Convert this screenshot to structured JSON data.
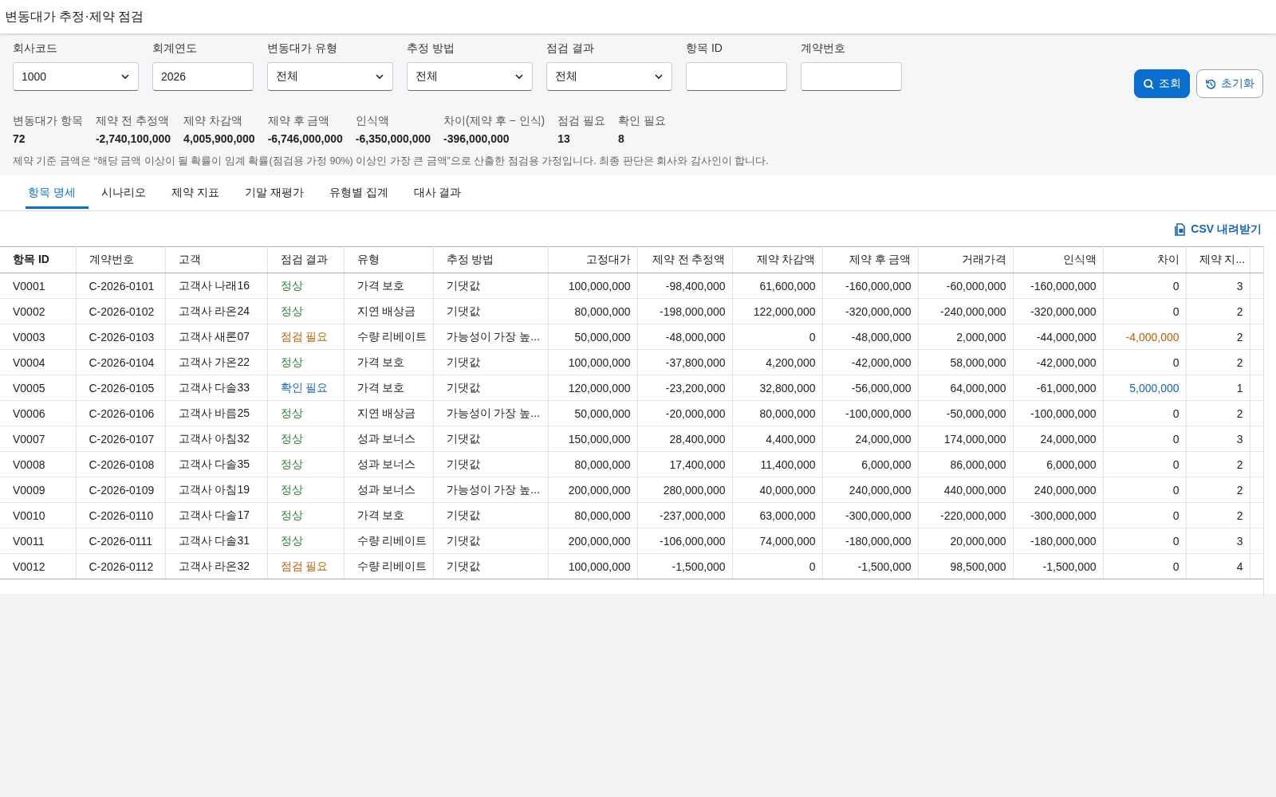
{
  "window": {
    "title": "변동대가 추정·제약 점검"
  },
  "filters": [
    {
      "label": "회사코드",
      "kind": "select",
      "value": "1000"
    },
    {
      "label": "회계연도",
      "kind": "input",
      "value": "2026"
    },
    {
      "label": "변동대가 유형",
      "kind": "select",
      "value": "전체"
    },
    {
      "label": "추정 방법",
      "kind": "select",
      "value": "전체"
    },
    {
      "label": "점검 결과",
      "kind": "select",
      "value": "전체"
    },
    {
      "label": "항목 ID",
      "kind": "input"
    },
    {
      "label": "계약번호",
      "kind": "input"
    }
  ],
  "buttons": [
    {
      "label": "조회",
      "kind": "primary"
    },
    {
      "label": "초기화",
      "kind": "reset"
    }
  ],
  "summary": [
    {
      "label": "변동대가 항목",
      "value": "72"
    },
    {
      "label": "제약 전 추정액",
      "value": "-2,740,100,000"
    },
    {
      "label": "제약 차감액",
      "value": "4,005,900,000"
    },
    {
      "label": "제약 후 금액",
      "value": "-6,746,000,000"
    },
    {
      "label": "인식액",
      "value": "-6,350,000,000"
    },
    {
      "label": "차이(제약 후 − 인식)",
      "value": "-396,000,000"
    },
    {
      "label": "점검 필요",
      "value": "13"
    },
    {
      "label": "확인 필요",
      "value": "8"
    }
  ],
  "note": "제약 기준 금액은 “해당 금액 이상이 될 확률이 임계 확률(점검용 가정 90%) 이상인 가장 큰 금액”으로 산출한 점검용 가정입니다. 최종 판단은 회사와 감사인이 합니다.",
  "tabs": [
    {
      "label": "항목 명세",
      "selected": true
    },
    {
      "label": "시나리오",
      "selected": false
    },
    {
      "label": "제약 지표",
      "selected": false
    },
    {
      "label": "기말 재평가",
      "selected": false
    },
    {
      "label": "유형별 집계",
      "selected": false
    },
    {
      "label": "대사 결과",
      "selected": false
    }
  ],
  "export_link": "CSV 내려받기",
  "table": {
    "columns": [
      "항목 ID",
      "계약번호",
      "고객",
      "점검 결과",
      "유형",
      "추정 방법",
      "고정대가",
      "제약 전 추정액",
      "제약 차감액",
      "제약 후 금액",
      "거래가격",
      "인식액",
      "차이",
      "제약 지..."
    ],
    "rows": [
      {
        "cells": [
          "V0001",
          "C-2026-0101",
          "고객사 나래16",
          {
            "text": "정상",
            "color": "#2e7d32"
          },
          "가격 보호",
          "기댓값",
          "100,000,000",
          "-98,400,000",
          "61,600,000",
          "-160,000,000",
          "-60,000,000",
          "-160,000,000",
          "0",
          "3"
        ]
      },
      {
        "cells": [
          "V0002",
          "C-2026-0102",
          "고객사 라온24",
          {
            "text": "정상",
            "color": "#2e7d32"
          },
          "지연 배상금",
          "기댓값",
          "80,000,000",
          "-198,000,000",
          "122,000,000",
          "-320,000,000",
          "-240,000,000",
          "-320,000,000",
          "0",
          "2"
        ]
      },
      {
        "cells": [
          "V0003",
          "C-2026-0103",
          "고객사 새론07",
          {
            "text": "점검 필요",
            "color": "#c0600a"
          },
          "수량 리베이트",
          "가능성이 가장 높...",
          "50,000,000",
          "-48,000,000",
          "0",
          "-48,000,000",
          "2,000,000",
          "-44,000,000",
          {
            "text": "-4,000,000",
            "color": "#c0600a"
          },
          "2"
        ]
      },
      {
        "cells": [
          "V0004",
          "C-2026-0104",
          "고객사 가온22",
          {
            "text": "정상",
            "color": "#2e7d32"
          },
          "가격 보호",
          "기댓값",
          "100,000,000",
          "-37,800,000",
          "4,200,000",
          "-42,000,000",
          "58,000,000",
          "-42,000,000",
          "0",
          "2"
        ]
      },
      {
        "cells": [
          "V0005",
          "C-2026-0105",
          "고객사 다솔33",
          {
            "text": "확인 필요",
            "color": "#1565c0"
          },
          "가격 보호",
          "기댓값",
          "120,000,000",
          "-23,200,000",
          "32,800,000",
          "-56,000,000",
          "64,000,000",
          "-61,000,000",
          {
            "text": "5,000,000",
            "color": "#1565c0"
          },
          "1"
        ]
      },
      {
        "cells": [
          "V0006",
          "C-2026-0106",
          "고객사 바름25",
          {
            "text": "정상",
            "color": "#2e7d32"
          },
          "지연 배상금",
          "가능성이 가장 높...",
          "50,000,000",
          "-20,000,000",
          "80,000,000",
          "-100,000,000",
          "-50,000,000",
          "-100,000,000",
          "0",
          "2"
        ]
      },
      {
        "cells": [
          "V0007",
          "C-2026-0107",
          "고객사 아침32",
          {
            "text": "정상",
            "color": "#2e7d32"
          },
          "성과 보너스",
          "기댓값",
          "150,000,000",
          "28,400,000",
          "4,400,000",
          "24,000,000",
          "174,000,000",
          "24,000,000",
          "0",
          "3"
        ]
      },
      {
        "cells": [
          "V0008",
          "C-2026-0108",
          "고객사 다솔35",
          {
            "text": "정상",
            "color": "#2e7d32"
          },
          "성과 보너스",
          "기댓값",
          "80,000,000",
          "17,400,000",
          "11,400,000",
          "6,000,000",
          "86,000,000",
          "6,000,000",
          "0",
          "2"
        ]
      },
      {
        "cells": [
          "V0009",
          "C-2026-0109",
          "고객사 아침19",
          {
            "text": "정상",
            "color": "#2e7d32"
          },
          "성과 보너스",
          "가능성이 가장 높...",
          "200,000,000",
          "280,000,000",
          "40,000,000",
          "240,000,000",
          "440,000,000",
          "240,000,000",
          "0",
          "2"
        ]
      },
      {
        "cells": [
          "V0010",
          "C-2026-0110",
          "고객사 다솔17",
          {
            "text": "정상",
            "color": "#2e7d32"
          },
          "가격 보호",
          "기댓값",
          "80,000,000",
          "-237,000,000",
          "63,000,000",
          "-300,000,000",
          "-220,000,000",
          "-300,000,000",
          "0",
          "2"
        ]
      },
      {
        "cells": [
          "V0011",
          "C-2026-0111",
          "고객사 다솔31",
          {
            "text": "정상",
            "color": "#2e7d32"
          },
          "수량 리베이트",
          "기댓값",
          "200,000,000",
          "-106,000,000",
          "74,000,000",
          "-180,000,000",
          "20,000,000",
          "-180,000,000",
          "0",
          "3"
        ]
      },
      {
        "cells": [
          "V0012",
          "C-2026-0112",
          "고객사 라온32",
          {
            "text": "점검 필요",
            "color": "#c0600a"
          },
          "수량 리베이트",
          "기댓값",
          "100,000,000",
          "-1,500,000",
          "0",
          "-1,500,000",
          "98,500,000",
          "-1,500,000",
          "0",
          "4"
        ]
      }
    ]
  }
}
